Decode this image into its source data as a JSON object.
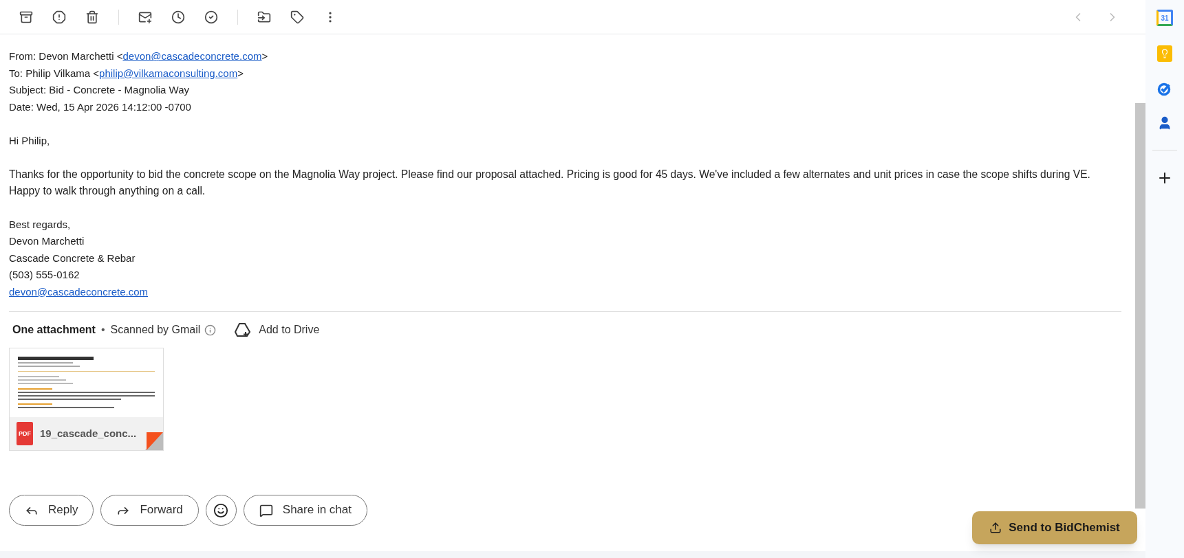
{
  "toolbar": {
    "actions": [
      {
        "kind": "archive"
      },
      {
        "kind": "spam"
      },
      {
        "kind": "delete"
      },
      {
        "kind": "divider"
      },
      {
        "kind": "unread"
      },
      {
        "kind": "snooze"
      },
      {
        "kind": "task"
      },
      {
        "kind": "divider"
      },
      {
        "kind": "move"
      },
      {
        "kind": "label"
      },
      {
        "kind": "more"
      }
    ],
    "nav": [
      {
        "kind": "prev",
        "disabled": true
      },
      {
        "kind": "next",
        "disabled": true
      }
    ]
  },
  "header_lines": [
    {
      "label": "From: Devon Marchetti <",
      "link": "devon@cascadeconcrete.com",
      "after": ">"
    },
    {
      "label": "To: Philip Vilkama <",
      "link": "philip@vilkamaconsulting.com",
      "after": ">"
    },
    {
      "label": "Subject: Bid - Concrete - Magnolia Way"
    },
    {
      "label": "Date: Wed, 15 Apr 2026 14:12:00 -0700"
    }
  ],
  "body": {
    "greeting": "Hi Philip,",
    "paragraph": "Thanks for the opportunity to bid the concrete scope on the Magnolia Way project. Please find our proposal attached. Pricing is good for 45 days. We've included a few alternates and unit prices in case the scope shifts during VE. Happy to walk through anything on a call.",
    "signature": [
      "Best regards,",
      "Devon Marchetti",
      "Cascade Concrete & Rebar",
      "(503) 555-0162"
    ],
    "signature_link": "devon@cascadeconcrete.com"
  },
  "attachments": {
    "title": "One attachment",
    "separator": "•",
    "scanned": "Scanned by Gmail",
    "add_to_drive": "Add to Drive",
    "files": [
      {
        "type": "PDF",
        "name": "19_cascade_conc..."
      }
    ]
  },
  "actions": [
    "Reply",
    "Forward",
    "Share in chat"
  ],
  "side_panel": {
    "calendar_day": "31"
  },
  "floating_button": "Send to BidChemist"
}
